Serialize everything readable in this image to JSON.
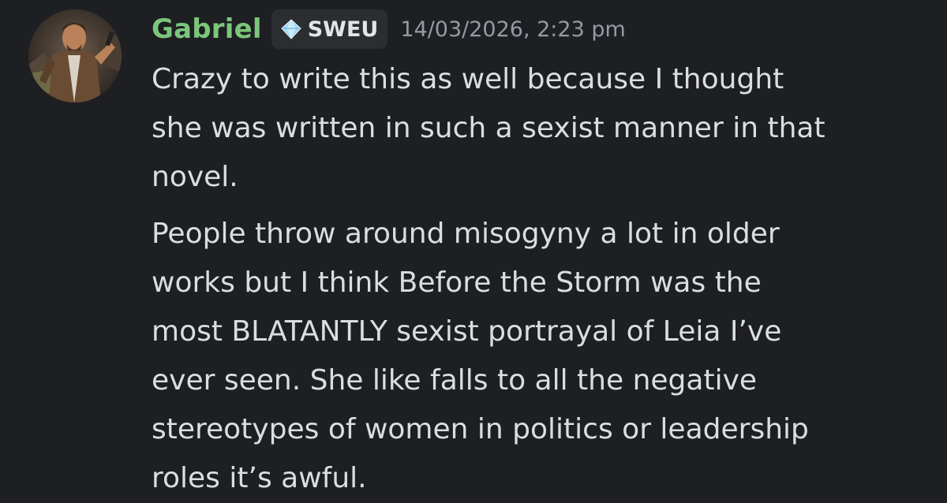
{
  "message": {
    "author": {
      "name": "Gabriel",
      "name_color": "#7bc67b",
      "avatar_icon": "avatar-comic-character"
    },
    "server_tag": {
      "icon": "diamond-icon",
      "label": "SWEU"
    },
    "timestamp": "14/03/2026, 2:23 pm",
    "paragraphs": [
      "Crazy to write this as well because I thought\nshe was written in such a sexist manner in that\nnovel.",
      "People throw around misogyny a lot in older\nworks but I think Before the Storm was the\nmost BLATANTLY sexist portrayal of Leia I’ve\never seen. She like falls to all the negative\nstereotypes of women in politics or leadership\nroles it’s awful."
    ]
  },
  "colors": {
    "background": "#1e1f22",
    "text": "#dbdee1",
    "muted": "#949ba4",
    "tag_background": "#2b2d31",
    "diamond": "#9fd6f2"
  }
}
